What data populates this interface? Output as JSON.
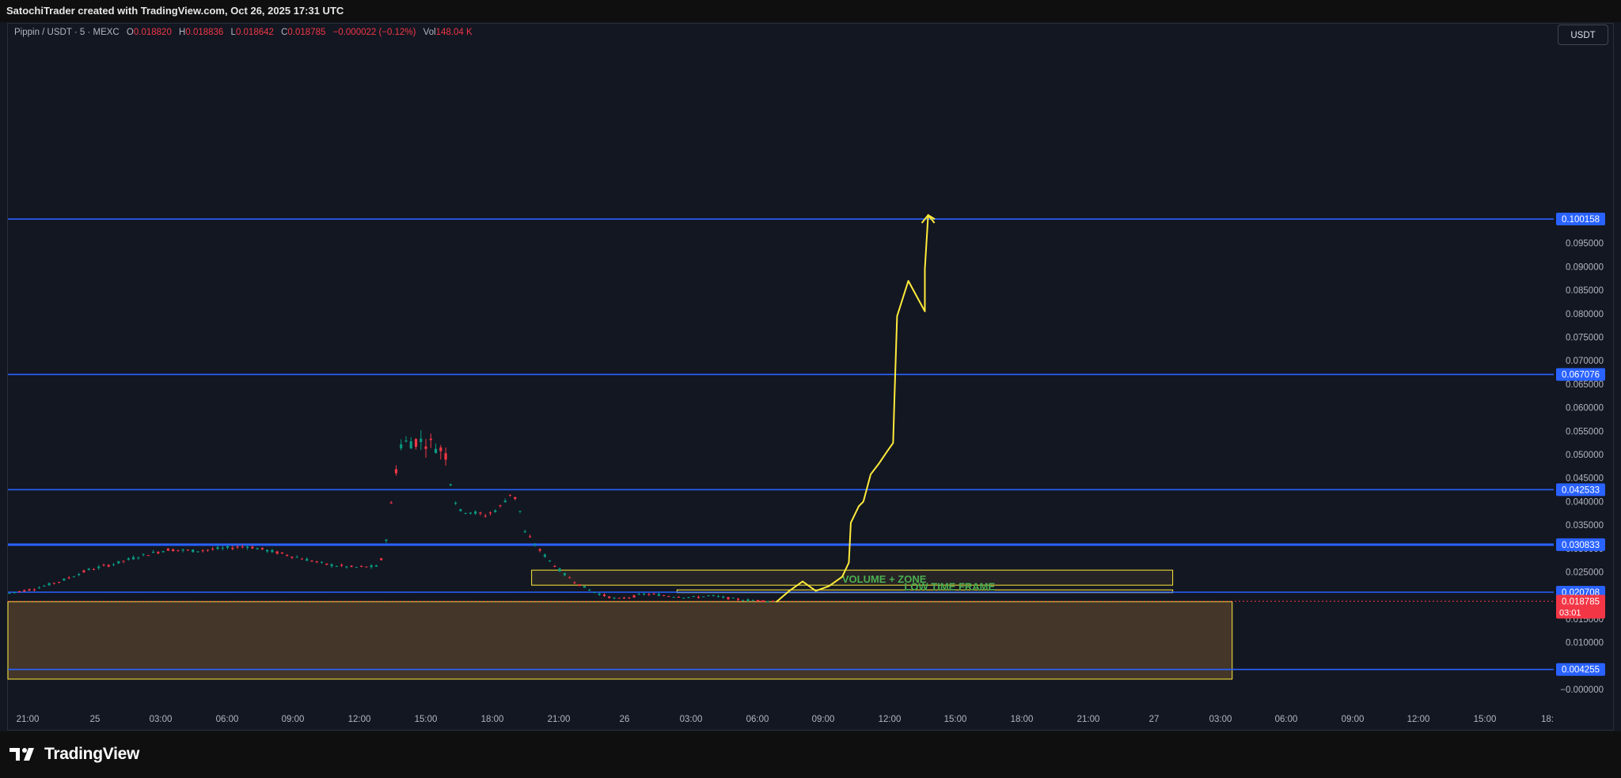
{
  "header": {
    "attribution": "SatochiTrader created with TradingView.com, Oct 26, 2025 17:31 UTC"
  },
  "legend": {
    "symbol": "Pippin / USDT · 5 · MEXC",
    "open_label": "O",
    "open": "0.018820",
    "high_label": "H",
    "high": "0.018836",
    "low_label": "L",
    "low": "0.018642",
    "close_label": "C",
    "close": "0.018785",
    "change": "−0.000022 (−0.12%)",
    "volume_label": "Vol",
    "volume": "148.04 K"
  },
  "currency_button": "USDT",
  "footer": {
    "brand": "TradingView"
  },
  "colors": {
    "background": "#131722",
    "level_line": "#2962ff",
    "projection": "#ffeb3b",
    "zone_fill": "#4a3b2a",
    "zone_text": "#4caf50",
    "up_candle": "#089981",
    "down_candle": "#f23645"
  },
  "chart_data": {
    "type": "line",
    "series": [
      {
        "values": [
          [
            0,
            0.0205
          ],
          [
            4,
            0.0215
          ],
          [
            8,
            0.0232
          ],
          [
            12,
            0.0255
          ],
          [
            16,
            0.0268
          ],
          [
            20,
            0.0285
          ],
          [
            24,
            0.0298
          ],
          [
            28,
            0.0295
          ],
          [
            32,
            0.03
          ],
          [
            36,
            0.0305
          ],
          [
            40,
            0.0293
          ],
          [
            44,
            0.028
          ],
          [
            48,
            0.0266
          ],
          [
            52,
            0.026
          ],
          [
            56,
            0.0262
          ],
          [
            57,
            0.032
          ],
          [
            58,
            0.042
          ],
          [
            59,
            0.052
          ],
          [
            61,
            0.053
          ],
          [
            63,
            0.0528
          ],
          [
            65,
            0.0515
          ],
          [
            66,
            0.05
          ],
          [
            67,
            0.042
          ],
          [
            68,
            0.038
          ],
          [
            70,
            0.0378
          ],
          [
            72,
            0.037
          ],
          [
            74,
            0.0385
          ],
          [
            76,
            0.042
          ],
          [
            77,
            0.0395
          ],
          [
            78,
            0.0335
          ],
          [
            80,
            0.03
          ],
          [
            82,
            0.027
          ],
          [
            84,
            0.0245
          ],
          [
            86,
            0.0225
          ],
          [
            88,
            0.021
          ],
          [
            90,
            0.02
          ],
          [
            92,
            0.0192
          ],
          [
            94,
            0.0197
          ],
          [
            96,
            0.0203
          ],
          [
            98,
            0.0202
          ],
          [
            100,
            0.0199
          ],
          [
            102,
            0.0197
          ],
          [
            104,
            0.0196
          ],
          [
            106,
            0.02
          ],
          [
            108,
            0.0196
          ],
          [
            110,
            0.0192
          ],
          [
            112,
            0.019
          ],
          [
            114,
            0.0189
          ],
          [
            116,
            0.01879
          ]
        ]
      }
    ],
    "projection_path": [
      [
        116,
        0.0186
      ],
      [
        118,
        0.021
      ],
      [
        120,
        0.023
      ],
      [
        122,
        0.021
      ],
      [
        124,
        0.022
      ],
      [
        126,
        0.024
      ],
      [
        127,
        0.027
      ],
      [
        127.3,
        0.0355
      ],
      [
        128.5,
        0.039
      ],
      [
        129.2,
        0.04
      ],
      [
        130.3,
        0.0458
      ],
      [
        131.5,
        0.048
      ],
      [
        132.7,
        0.0505
      ],
      [
        133.7,
        0.0525
      ],
      [
        133.9,
        0.062
      ],
      [
        134.3,
        0.0795
      ],
      [
        136.0,
        0.087
      ],
      [
        138.5,
        0.0805
      ],
      [
        138.5,
        0.0895
      ],
      [
        139,
        0.101
      ],
      [
        140,
        0.10015
      ]
    ],
    "levels": [
      {
        "price": 0.100158,
        "label": "0.100158"
      },
      {
        "price": 0.067076,
        "label": "0.067076"
      },
      {
        "price": 0.042533,
        "label": "0.042533"
      },
      {
        "price": 0.030833,
        "label": "0.030833"
      },
      {
        "price": 0.020708,
        "label": "0.020708"
      },
      {
        "price": 0.004255,
        "label": "0.004255"
      }
    ],
    "current_price": {
      "price": 0.018785,
      "label": "0.018785",
      "countdown": "03:01"
    },
    "zones": [
      {
        "name": "VOLUME + ZONE",
        "label": "VOLUME + ZONE",
        "x_from": 79,
        "x_to": 176,
        "y_from": 0.0222,
        "y_to": 0.0254
      },
      {
        "name": "LOW TIME FRAME",
        "label": "LOW TIME FRAME",
        "x_from": 101,
        "x_to": 176,
        "y_from": 0.0206,
        "y_to": 0.0212
      },
      {
        "name": "lower-range",
        "label": "",
        "x_from": -1,
        "x_to": 185,
        "y_from": 0.0022,
        "y_to": 0.0187
      }
    ],
    "y_ticks": [
      "0.095000",
      "0.090000",
      "0.085000",
      "0.080000",
      "0.075000",
      "0.070000",
      "0.065000",
      "0.060000",
      "0.055000",
      "0.050000",
      "0.045000",
      "0.040000",
      "0.035000",
      "0.030000",
      "0.025000",
      "0.015000",
      "0.010000",
      "−0.000000"
    ],
    "x_ticks": [
      "21:00",
      "25",
      "03:00",
      "06:00",
      "09:00",
      "12:00",
      "15:00",
      "18:00",
      "21:00",
      "26",
      "03:00",
      "06:00",
      "09:00",
      "12:00",
      "15:00",
      "18:00",
      "21:00",
      "27",
      "03:00",
      "06:00",
      "09:00",
      "12:00",
      "15:00",
      "18:"
    ],
    "ylim": [
      -0.0005,
      0.1035
    ]
  }
}
